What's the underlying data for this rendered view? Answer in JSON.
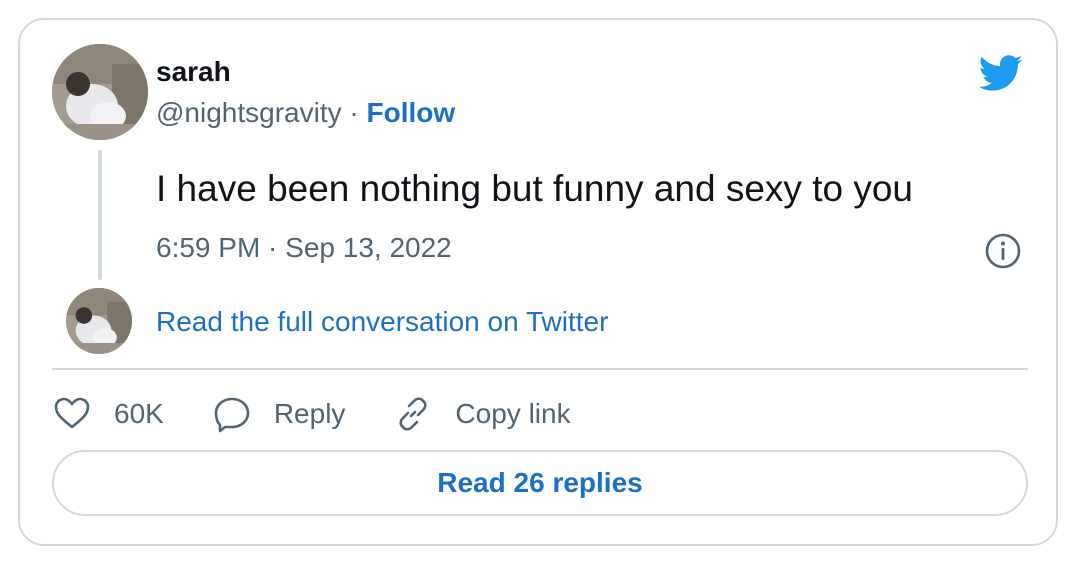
{
  "author": {
    "display_name": "sarah",
    "handle": "@nightsgravity",
    "separator": " · ",
    "follow_label": "Follow"
  },
  "tweet": {
    "text": "I have been nothing but funny and sexy to you",
    "timestamp": "6:59 PM · Sep 13, 2022"
  },
  "conversation_link": "Read the full conversation on Twitter",
  "actions": {
    "like_count": "60K",
    "reply_label": "Reply",
    "copy_link_label": "Copy link"
  },
  "read_replies_label": "Read 26 replies",
  "colors": {
    "link_blue": "#1d6fc2",
    "twitter_blue": "#1d9bf0",
    "text_primary": "#0f1419",
    "text_secondary": "#536471",
    "border": "#cfd9de"
  },
  "icons": [
    "twitter-bird-icon",
    "info-icon",
    "heart-icon",
    "reply-bubble-icon",
    "link-icon"
  ]
}
